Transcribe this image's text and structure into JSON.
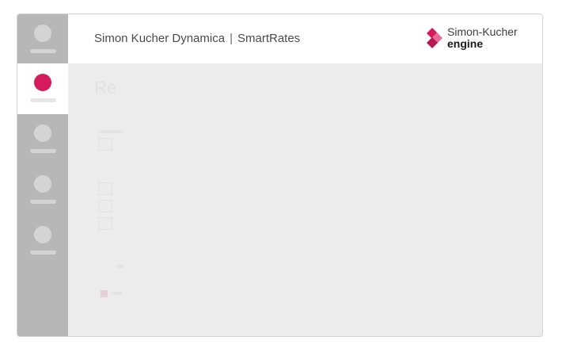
{
  "header": {
    "app_name": "Simon Kucher Dynamica",
    "separator": "|",
    "module_name": "SmartRates"
  },
  "brand": {
    "name": "Simon-Kucher",
    "product": "engine",
    "logo_icon": "diamond-chevron-icon",
    "color": "#d41c5c"
  },
  "sidebar": {
    "active_index": 1,
    "accent": "#d41c5c",
    "items": [
      {
        "icon": "nav-dot-icon"
      },
      {
        "icon": "nav-dot-icon"
      },
      {
        "icon": "nav-dot-icon"
      },
      {
        "icon": "nav-dot-icon"
      },
      {
        "icon": "nav-dot-icon"
      }
    ]
  },
  "main": {
    "heading": "Re"
  }
}
